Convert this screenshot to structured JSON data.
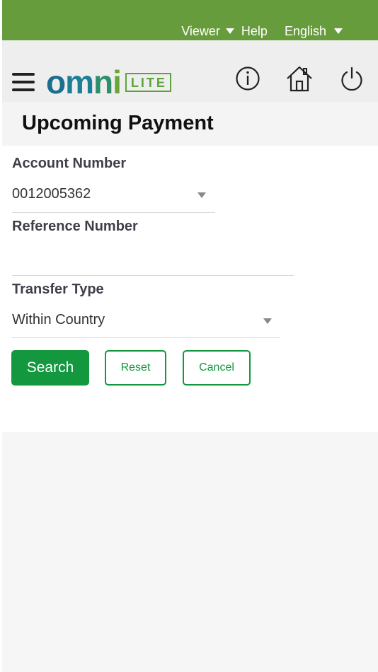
{
  "topbar": {
    "viewer_label": "Viewer",
    "help_label": "Help",
    "language_label": "English",
    "background_color": "#679c3c"
  },
  "header": {
    "logo_letters": [
      "o",
      "m",
      "n",
      "i"
    ],
    "logo_badge": "LITE",
    "icons": [
      "menu-icon",
      "info-icon",
      "home-icon",
      "power-icon"
    ]
  },
  "page": {
    "title": "Upcoming Payment"
  },
  "form": {
    "account_number": {
      "label": "Account Number",
      "value": "0012005362"
    },
    "reference_number": {
      "label": "Reference Number",
      "value": ""
    },
    "transfer_type": {
      "label": "Transfer Type",
      "value": "Within Country"
    }
  },
  "buttons": {
    "search_label": "Search",
    "reset_label": "Reset",
    "cancel_label": "Cancel",
    "accent_color": "#13973f"
  }
}
